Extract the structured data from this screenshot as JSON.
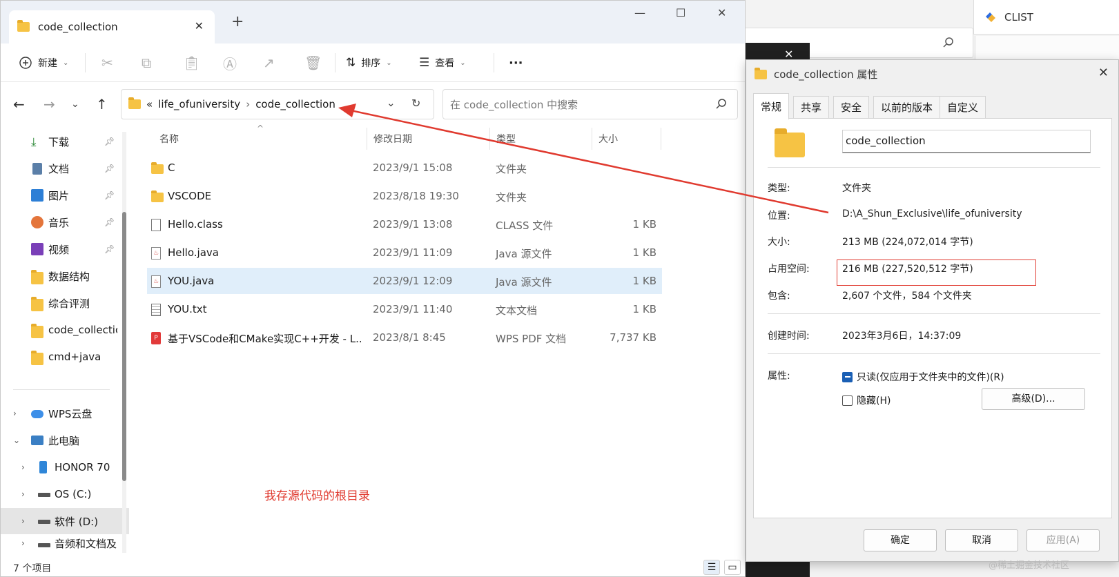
{
  "background": {
    "clist_label": "CLIST"
  },
  "explorer": {
    "tab_title": "code_collection",
    "toolbar": {
      "new_label": "新建",
      "sort_label": "排序",
      "view_label": "查看",
      "more_label": "···"
    },
    "address": {
      "overflow": "«",
      "segments": [
        "life_ofuniversity",
        "code_collection"
      ],
      "search_placeholder": "在 code_collection 中搜索"
    },
    "sidebar": {
      "quick_access": [
        {
          "label": "下载",
          "icon": "download-icon"
        },
        {
          "label": "文档",
          "icon": "document-icon"
        },
        {
          "label": "图片",
          "icon": "pictures-icon"
        },
        {
          "label": "音乐",
          "icon": "music-icon"
        },
        {
          "label": "视频",
          "icon": "video-icon"
        },
        {
          "label": "数据结构",
          "icon": "folder-icon"
        },
        {
          "label": "综合评测",
          "icon": "folder-icon"
        },
        {
          "label": "code_collection",
          "icon": "folder-icon"
        },
        {
          "label": "cmd+java",
          "icon": "folder-icon"
        }
      ],
      "tree": [
        {
          "label": "WPS云盘",
          "icon": "cloud-icon"
        },
        {
          "label": "此电脑",
          "icon": "computer-icon"
        },
        {
          "label": "HONOR 70",
          "icon": "phone-icon"
        },
        {
          "label": "OS (C:)",
          "icon": "drive-icon"
        },
        {
          "label": "软件 (D:)",
          "icon": "drive-icon"
        },
        {
          "label": "音频和文档及",
          "icon": "drive-icon"
        }
      ]
    },
    "columns": [
      "名称",
      "修改日期",
      "类型",
      "大小"
    ],
    "files": [
      {
        "name": "C",
        "date": "2023/9/1 15:08",
        "type": "文件夹",
        "size": ""
      },
      {
        "name": "VSCODE",
        "date": "2023/8/18 19:30",
        "type": "文件夹",
        "size": ""
      },
      {
        "name": "Hello.class",
        "date": "2023/9/1 13:08",
        "type": "CLASS 文件",
        "size": "1 KB"
      },
      {
        "name": "Hello.java",
        "date": "2023/9/1 11:09",
        "type": "Java 源文件",
        "size": "1 KB"
      },
      {
        "name": "YOU.java",
        "date": "2023/9/1 12:09",
        "type": "Java 源文件",
        "size": "1 KB"
      },
      {
        "name": "YOU.txt",
        "date": "2023/9/1 11:40",
        "type": "文本文档",
        "size": "1 KB"
      },
      {
        "name": "基于VSCode和CMake实现C++开发 - L...",
        "date": "2023/8/1 8:45",
        "type": "WPS PDF 文档",
        "size": "7,737 KB"
      }
    ],
    "annotation": "我存源代码的根目录",
    "status": "7 个项目"
  },
  "properties": {
    "title": "code_collection 属性",
    "tabs": [
      "常规",
      "共享",
      "安全",
      "以前的版本",
      "自定义"
    ],
    "name": "code_collection",
    "type_label": "类型:",
    "type_value": "文件夹",
    "location_label": "位置:",
    "location_value": "D:\\A_Shun_Exclusive\\life_ofuniversity",
    "size_label": "大小:",
    "size_value": "213 MB (224,072,014 字节)",
    "disk_label": "占用空间:",
    "disk_value": "216 MB (227,520,512 字节)",
    "contains_label": "包含:",
    "contains_value": "2,607 个文件，584 个文件夹",
    "created_label": "创建时间:",
    "created_value": "2023年3月6日，14:37:09",
    "attrs_label": "属性:",
    "readonly_label": "只读(仅应用于文件夹中的文件)(R)",
    "hidden_label": "隐藏(H)",
    "advanced_label": "高级(D)...",
    "ok_label": "确定",
    "cancel_label": "取消",
    "apply_label": "应用(A)"
  },
  "watermark": "@稀土掘金技术社区",
  "colors": {
    "accent": "#1a5fb4",
    "annotation_red": "#e03a2f",
    "folder": "#f6c344",
    "selected_row": "#e0eefa"
  }
}
